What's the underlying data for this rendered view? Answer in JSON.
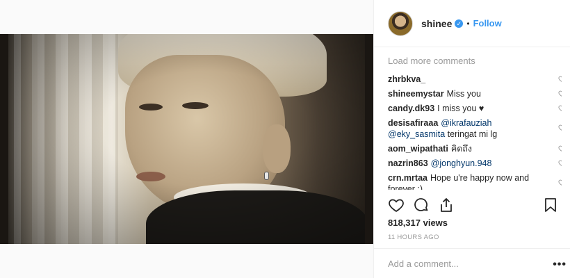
{
  "post": {
    "account": {
      "username": "shinee",
      "verified": true,
      "follow_label": "Follow",
      "separator": "•"
    },
    "load_more_label": "Load more comments",
    "comments": [
      {
        "user": "zhrbkva_",
        "text": ""
      },
      {
        "user": "shineemystar",
        "text": "Miss you"
      },
      {
        "user": "candy.dk93",
        "text": "I miss you ♥"
      },
      {
        "user": "desisafiraaa",
        "mention": "@ikrafauziah",
        "mention2": "@eky_sasmita",
        "text": "teringat mi lg"
      },
      {
        "user": "aom_wipathati",
        "text": "คิดถึง"
      },
      {
        "user": "nazrin863",
        "mention": "@jonghyun.948",
        "text": ""
      },
      {
        "user": "crn.mrtaa",
        "text": "Hope u're happy now and forever :)"
      }
    ],
    "views": "818,317 views",
    "timestamp": "11 HOURS AGO",
    "add_comment_placeholder": "Add a comment...",
    "more_options_label": "•••"
  },
  "icons": [
    "heart-icon",
    "comment-icon",
    "share-icon",
    "bookmark-icon",
    "verified-badge-icon"
  ]
}
